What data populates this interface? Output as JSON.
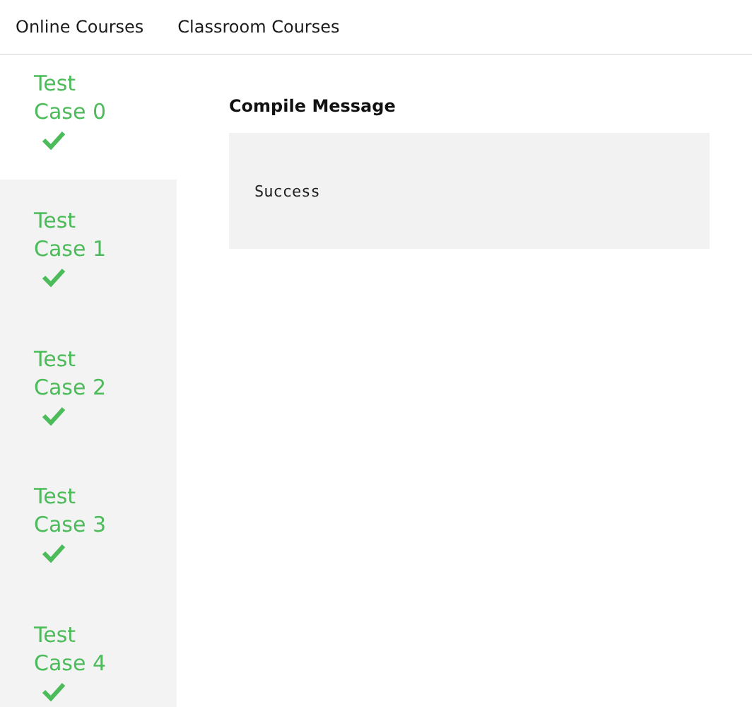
{
  "nav": {
    "links": [
      "Online Courses",
      "Classroom Courses"
    ]
  },
  "test_cases": [
    {
      "label": "Test Case 0",
      "selected": true,
      "passed": true
    },
    {
      "label": "Test Case 1",
      "selected": false,
      "passed": true
    },
    {
      "label": "Test Case 2",
      "selected": false,
      "passed": true
    },
    {
      "label": "Test Case 3",
      "selected": false,
      "passed": true
    },
    {
      "label": "Test Case 4",
      "selected": false,
      "passed": true
    }
  ],
  "result": {
    "heading": "Compile Message",
    "message": "Success"
  }
}
